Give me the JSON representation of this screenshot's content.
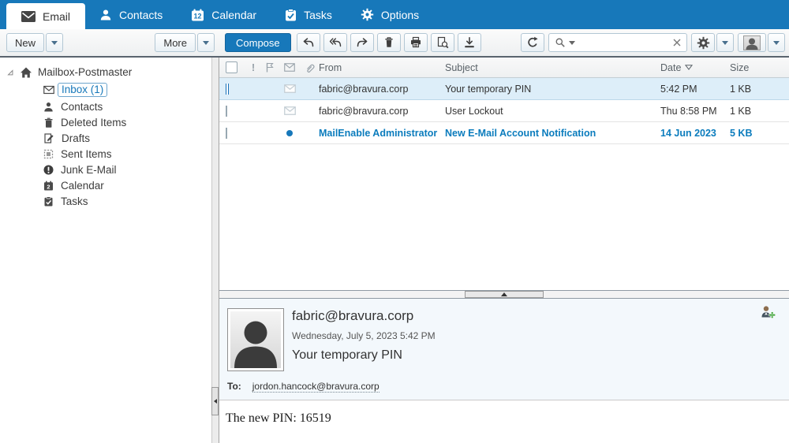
{
  "navbar": {
    "tabs": [
      {
        "label": "Email"
      },
      {
        "label": "Contacts"
      },
      {
        "label": "Calendar"
      },
      {
        "label": "Tasks"
      },
      {
        "label": "Options"
      }
    ]
  },
  "toolbar": {
    "new_label": "New",
    "more_label": "More",
    "compose_label": "Compose",
    "search_value": "",
    "search_placeholder": ""
  },
  "icons": {
    "calendar_nav_badge": "12",
    "calendar_tree_badge": "2",
    "names": [
      "envelope-icon",
      "person-icon",
      "calendar-icon",
      "tasks-icon",
      "gear-icon",
      "reply-icon",
      "reply-all-icon",
      "forward-icon",
      "delete-icon",
      "print-icon",
      "view-source-icon",
      "download-icon",
      "refresh-icon",
      "search-icon",
      "clear-search-icon",
      "settings-icon",
      "account-icon",
      "home-icon",
      "drafts-icon",
      "sent-items-icon",
      "junk-icon",
      "flag-icon",
      "paperclip-icon",
      "add-contact-icon",
      "collapse-left-icon",
      "collapse-up-icon",
      "sort-desc-icon"
    ]
  },
  "sidebar": {
    "root_label": "Mailbox-Postmaster",
    "items": [
      {
        "label": "Inbox (1)"
      },
      {
        "label": "Contacts"
      },
      {
        "label": "Deleted Items"
      },
      {
        "label": "Drafts"
      },
      {
        "label": "Sent Items"
      },
      {
        "label": "Junk E-Mail"
      },
      {
        "label": "Calendar"
      },
      {
        "label": "Tasks"
      }
    ]
  },
  "message_list": {
    "columns": {
      "importance": "!",
      "from": "From",
      "subject": "Subject",
      "date": "Date",
      "size": "Size"
    },
    "rows": [
      {
        "from": "fabric@bravura.corp",
        "subject": "Your temporary PIN",
        "date": "5:42 PM",
        "size": "1 KB"
      },
      {
        "from": "fabric@bravura.corp",
        "subject": "User Lockout",
        "date": "Thu 8:58 PM",
        "size": "1 KB"
      },
      {
        "from": "MailEnable Administrator",
        "subject": "New E-Mail Account Notification",
        "date": "14 Jun 2023",
        "size": "5 KB"
      }
    ]
  },
  "preview": {
    "from": "fabric@bravura.corp",
    "date": "Wednesday, July 5, 2023 5:42 PM",
    "subject": "Your temporary PIN",
    "to_label": "To:",
    "to_address": "jordon.hancock@bravura.corp",
    "body": "The new PIN: 16519"
  },
  "colors": {
    "accent": "#1778ba",
    "unread": "#0b7cbd",
    "selected_row": "#ddeef9",
    "checkbox_checked": "#1b84d8",
    "toolbar_border": "#5a646e"
  }
}
